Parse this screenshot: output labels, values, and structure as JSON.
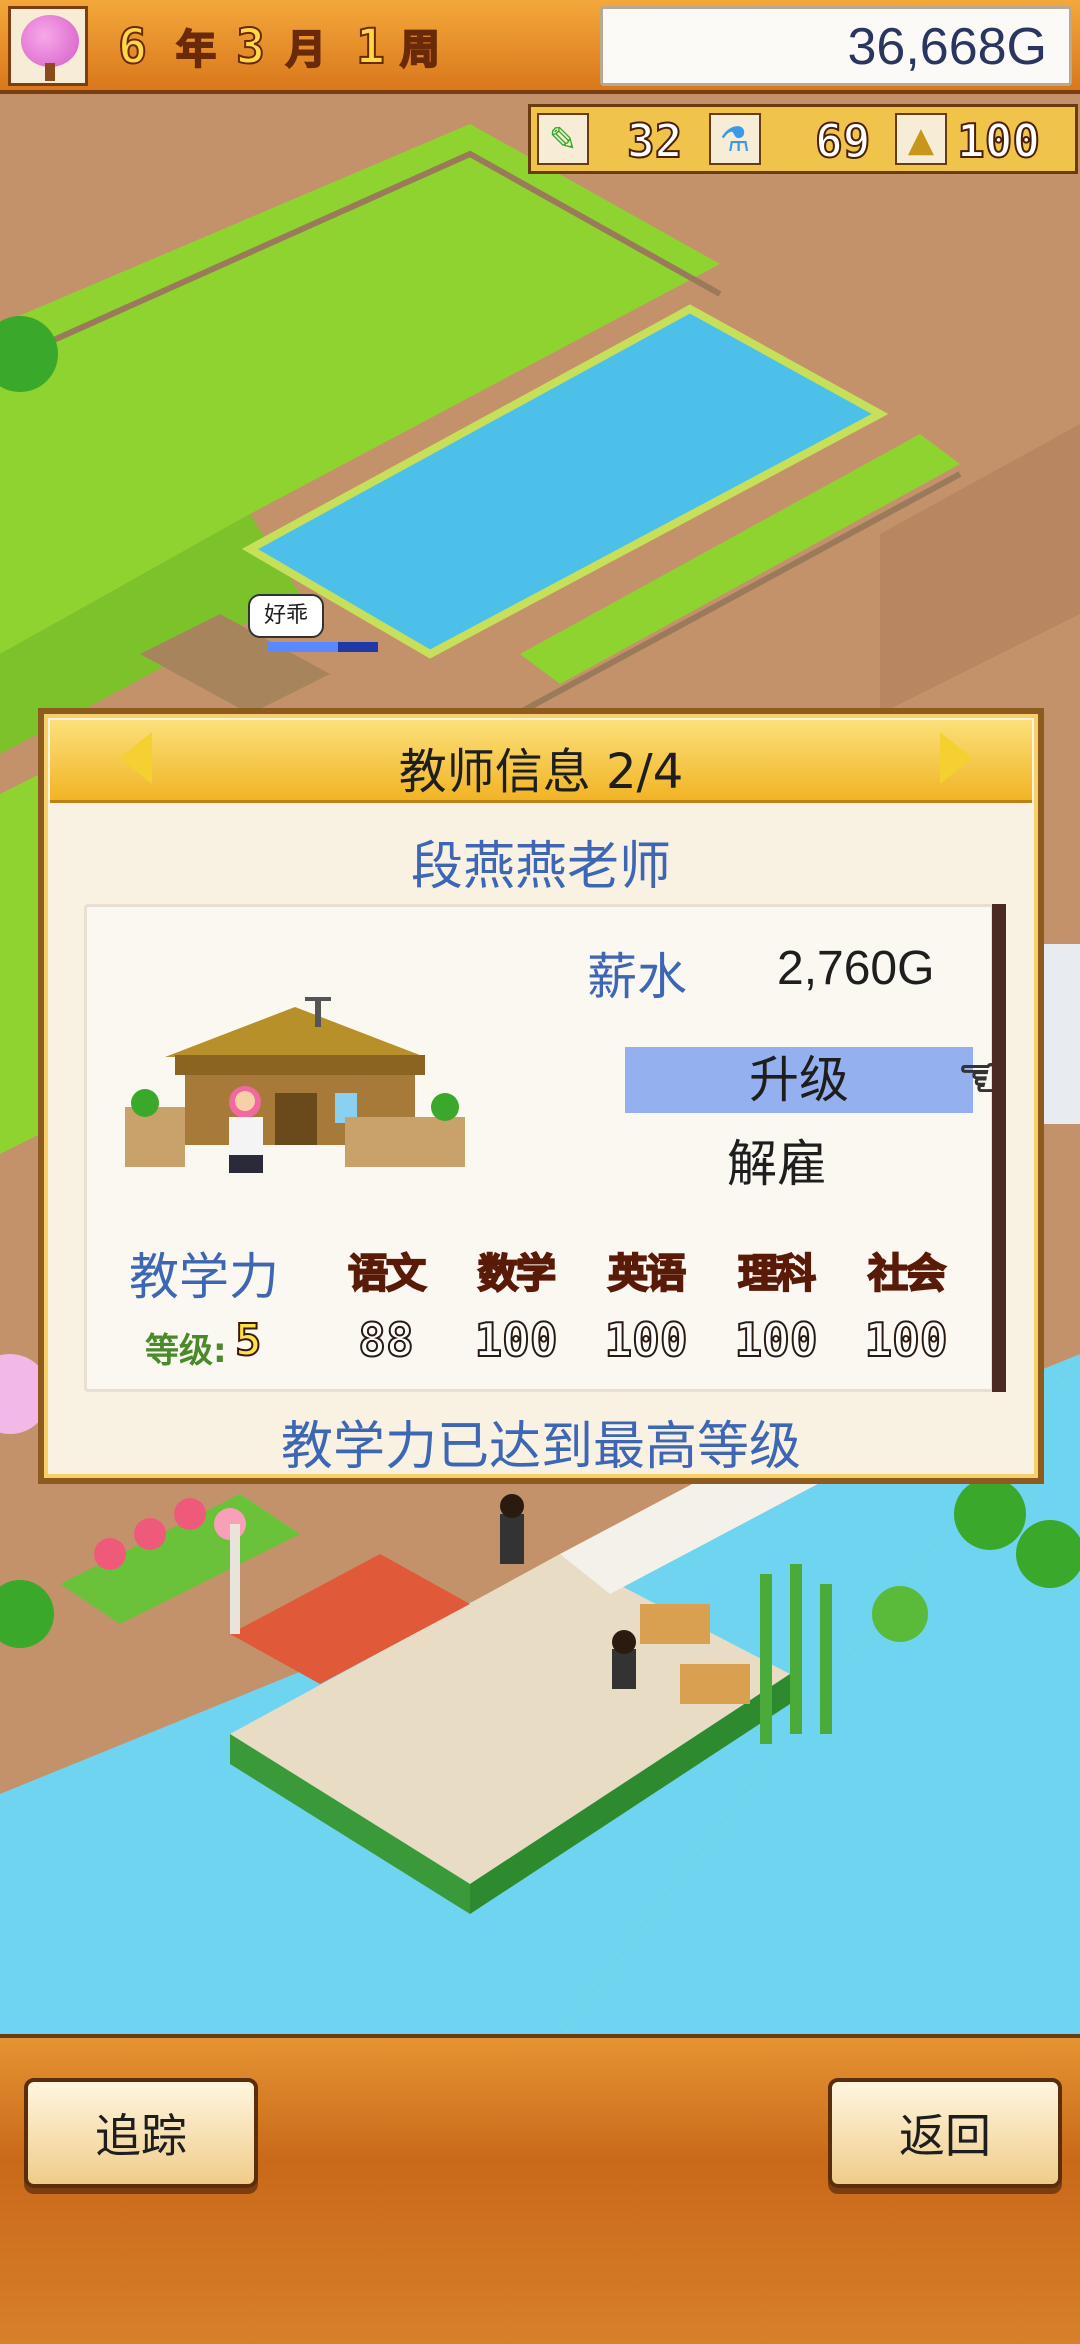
{
  "topbar": {
    "year_num": "6",
    "year_unit": "年",
    "month_num": "3",
    "month_unit": "月",
    "week_num": "1",
    "week_unit": "周",
    "money": "36,668G"
  },
  "resources": [
    {
      "icon": "pencil-icon",
      "value": "32"
    },
    {
      "icon": "flask-icon",
      "value": "69"
    },
    {
      "icon": "pyramid-icon",
      "value": "100"
    }
  ],
  "map": {
    "speech_bubble": "好乖"
  },
  "panel": {
    "title": "教师信息 2/4",
    "teacher_name": "段燕燕老师",
    "salary_label": "薪水",
    "salary_value": "2,760G",
    "upgrade_label": "升级",
    "fire_label": "解雇",
    "teaching_label": "教学力",
    "level_label": "等级:",
    "level_value": "5",
    "subjects": [
      {
        "name": "语文",
        "score": "88"
      },
      {
        "name": "数学",
        "score": "100"
      },
      {
        "name": "英语",
        "score": "100"
      },
      {
        "name": "理科",
        "score": "100"
      },
      {
        "name": "社会",
        "score": "100"
      }
    ],
    "status_text": "教学力已达到最高等级"
  },
  "bottom": {
    "track_label": "追踪",
    "back_label": "返回"
  },
  "colors": {
    "accent_blue": "#3d66b4",
    "highlight": "#95b0ef",
    "panel_bg": "#f9f1e2",
    "header_gold": "#f2b425"
  }
}
